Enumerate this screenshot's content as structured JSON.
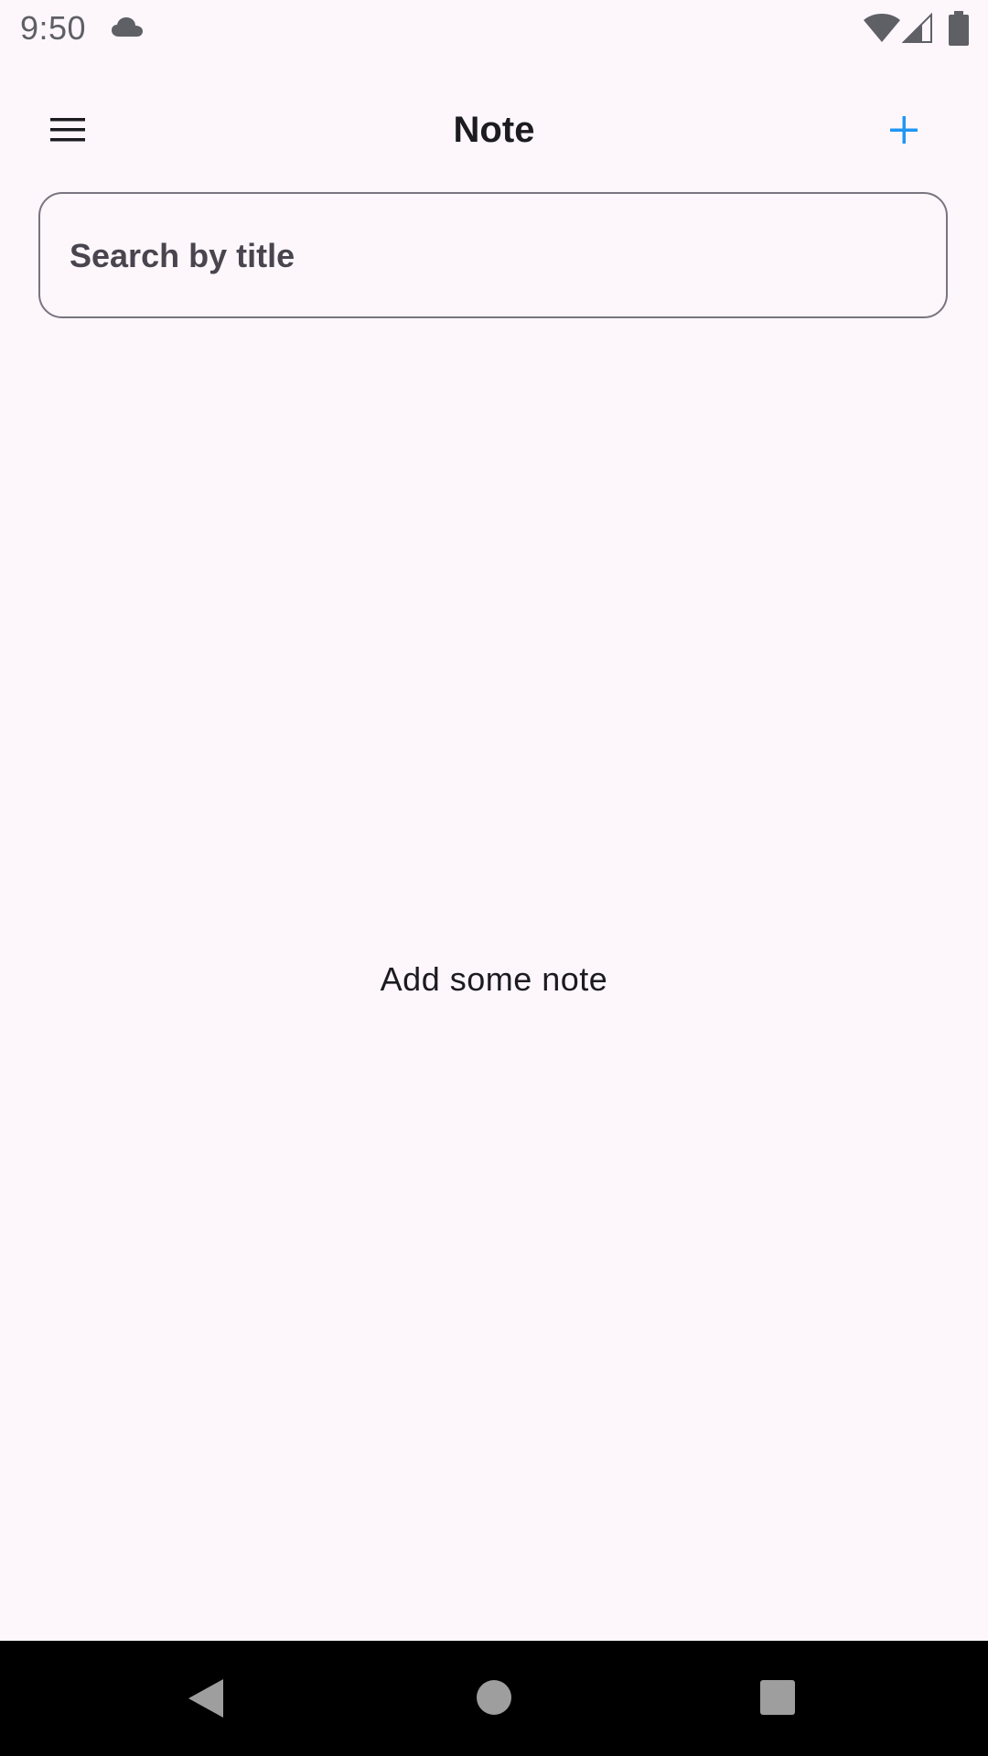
{
  "status_bar": {
    "time": "9:50",
    "icons": [
      "cloud-icon",
      "wifi-icon",
      "signal-icon",
      "battery-icon"
    ]
  },
  "app_bar": {
    "title": "Note",
    "menu_icon": "hamburger-menu-icon",
    "add_icon": "plus-icon"
  },
  "search": {
    "placeholder": "Search by title",
    "value": ""
  },
  "main": {
    "empty_message": "Add some note"
  },
  "nav_bar": {
    "icons": [
      "back-triangle-icon",
      "home-circle-icon",
      "recents-square-icon"
    ]
  },
  "colors": {
    "background": "#fdf7fc",
    "accent": "#2196f3",
    "text_primary": "#1c1b1f",
    "outline": "#79747e",
    "status_icons": "#5f5f66",
    "nav_bar": "#000000",
    "nav_icons": "#9e9e9e"
  }
}
